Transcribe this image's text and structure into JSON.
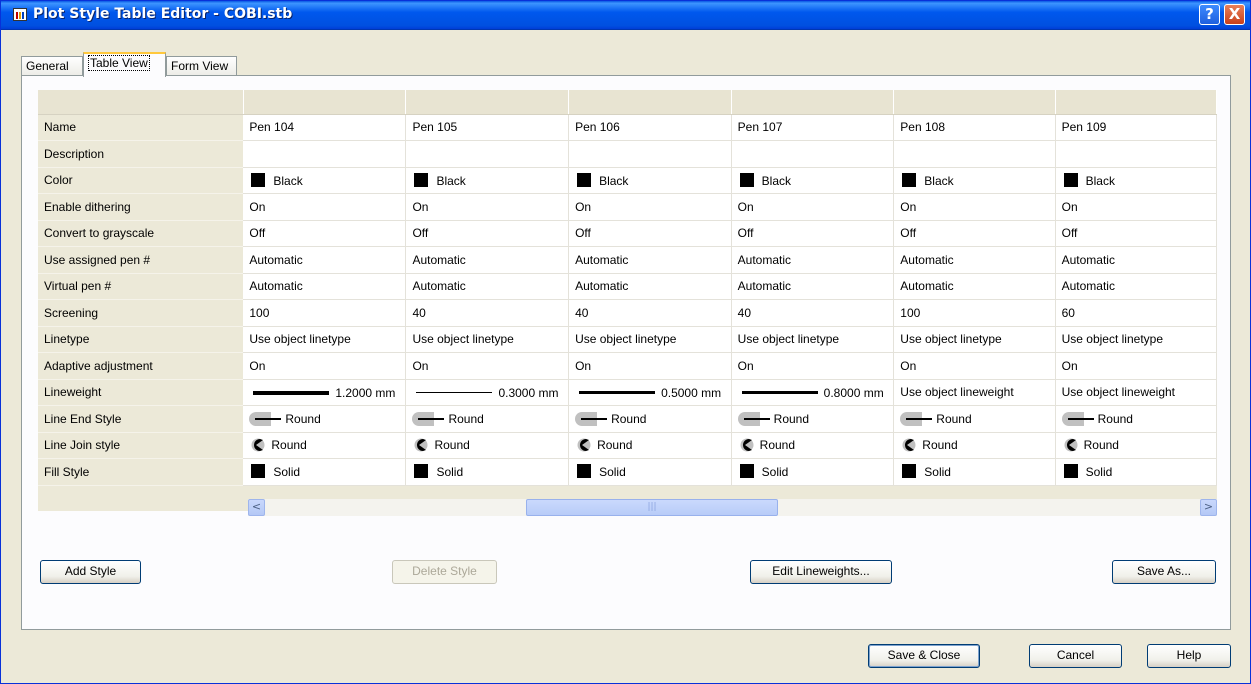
{
  "window": {
    "title": "Plot Style Table Editor - COBI.stb",
    "help_label": "?",
    "close_label": "X"
  },
  "tabs": [
    {
      "label": "General",
      "active": false
    },
    {
      "label": "Table View",
      "active": true
    },
    {
      "label": "Form View",
      "active": false
    }
  ],
  "grid": {
    "row_labels": [
      "Name",
      "Description",
      "Color",
      "Enable dithering",
      "Convert to grayscale",
      "Use assigned pen #",
      "Virtual pen #",
      "Screening",
      "Linetype",
      "Adaptive adjustment",
      "Lineweight",
      "Line End Style",
      "Line Join style",
      "Fill Style"
    ],
    "columns": [
      {
        "name": "Pen 104",
        "description": "",
        "color": "Black",
        "dithering": "On",
        "grayscale": "Off",
        "assigned_pen": "Automatic",
        "virtual_pen": "Automatic",
        "screening": "100",
        "linetype": "Use object linetype",
        "adaptive": "On",
        "lineweight": "1.2000 mm",
        "line_end": "Round",
        "line_join": "Round",
        "fill": "Solid"
      },
      {
        "name": "Pen 105",
        "description": "",
        "color": "Black",
        "dithering": "On",
        "grayscale": "Off",
        "assigned_pen": "Automatic",
        "virtual_pen": "Automatic",
        "screening": "40",
        "linetype": "Use object linetype",
        "adaptive": "On",
        "lineweight": "0.3000 mm",
        "line_end": "Round",
        "line_join": "Round",
        "fill": "Solid"
      },
      {
        "name": "Pen 106",
        "description": "",
        "color": "Black",
        "dithering": "On",
        "grayscale": "Off",
        "assigned_pen": "Automatic",
        "virtual_pen": "Automatic",
        "screening": "40",
        "linetype": "Use object linetype",
        "adaptive": "On",
        "lineweight": "0.5000 mm",
        "line_end": "Round",
        "line_join": "Round",
        "fill": "Solid"
      },
      {
        "name": "Pen 107",
        "description": "",
        "color": "Black",
        "dithering": "On",
        "grayscale": "Off",
        "assigned_pen": "Automatic",
        "virtual_pen": "Automatic",
        "screening": "40",
        "linetype": "Use object linetype",
        "adaptive": "On",
        "lineweight": "0.8000 mm",
        "line_end": "Round",
        "line_join": "Round",
        "fill": "Solid"
      },
      {
        "name": "Pen 108",
        "description": "",
        "color": "Black",
        "dithering": "On",
        "grayscale": "Off",
        "assigned_pen": "Automatic",
        "virtual_pen": "Automatic",
        "screening": "100",
        "linetype": "Use object linetype",
        "adaptive": "On",
        "lineweight": "Use object lineweight",
        "line_end": "Round",
        "line_join": "Round",
        "fill": "Solid"
      },
      {
        "name": "Pen 109",
        "description": "",
        "color": "Black",
        "dithering": "On",
        "grayscale": "Off",
        "assigned_pen": "Automatic",
        "virtual_pen": "Automatic",
        "screening": "60",
        "linetype": "Use object linetype",
        "adaptive": "On",
        "lineweight": "Use object lineweight",
        "line_end": "Round",
        "line_join": "Round",
        "fill": "Solid"
      }
    ]
  },
  "scrollbar": {
    "left_arrow": "<",
    "right_arrow": ">",
    "thumb_grip": "|||"
  },
  "buttons": {
    "add_style": "Add Style",
    "delete_style": "Delete Style",
    "edit_lineweights": "Edit Lineweights...",
    "save_as": "Save As...",
    "save_close": "Save & Close",
    "cancel": "Cancel",
    "help": "Help"
  },
  "colors": {
    "titlebar": "#0058EE",
    "face": "#ECE9D8",
    "swatch": "#000000"
  }
}
